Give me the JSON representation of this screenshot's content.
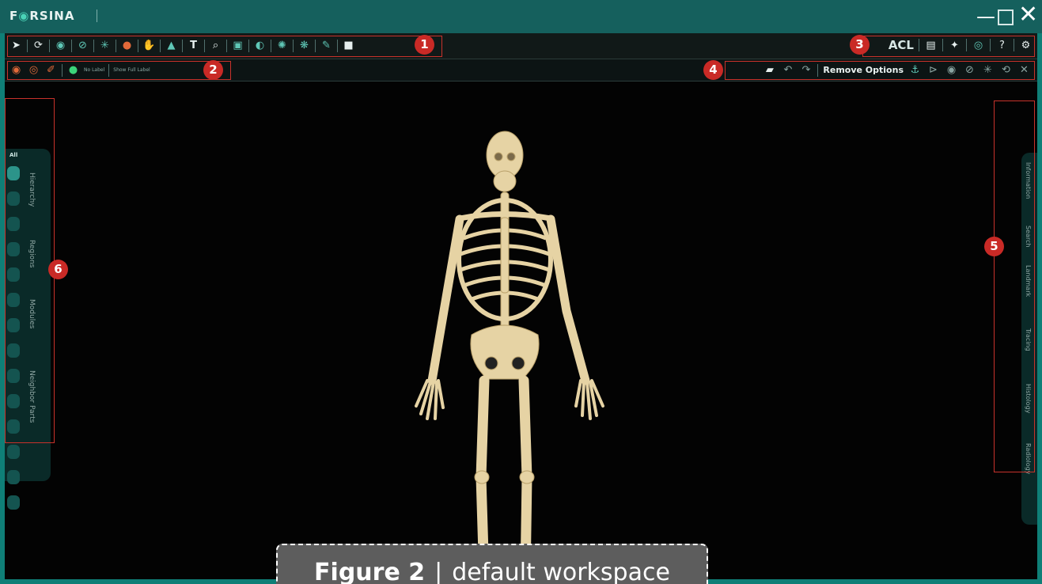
{
  "window": {
    "app_name_pre": "F",
    "app_name_o": "◉",
    "app_name_post": "RSINA",
    "minimize": "—",
    "close": "✕"
  },
  "toolbar_main": {
    "icons": [
      "pointer-icon",
      "rotate-icon",
      "eye-icon",
      "hide-icon",
      "explode-icon",
      "dot-icon",
      "hand-icon",
      "layer-icon",
      "text-icon",
      "zoom-icon",
      "image-icon",
      "mirror-icon",
      "atom-icon",
      "molecule-icon",
      "draw-icon",
      "video-icon"
    ],
    "acl_label": "ACL",
    "right_icons": [
      "document-icon",
      "puzzle-icon",
      "settings-circle-icon",
      "help-icon",
      "gear-icon"
    ]
  },
  "toolbar_secondary": {
    "no_label": "No Label",
    "show_full_label": "Show Full Label",
    "remove_options_label": "Remove Options"
  },
  "callouts": {
    "m1": "1",
    "m2": "2",
    "m3": "3",
    "m4": "4",
    "m5": "5",
    "m6": "6"
  },
  "left_panel": {
    "all_label": "All",
    "tabs": [
      "Hierarchy",
      "Regions",
      "Modules",
      "Neighbor Parts"
    ]
  },
  "right_panel": {
    "tabs": [
      "Information",
      "Search",
      "Landmark",
      "Tracing",
      "Histology",
      "Radiology"
    ]
  },
  "caption": {
    "figure_label": "Figure 2",
    "separator": "|",
    "description": "default workspace"
  },
  "colors": {
    "frame": "#0f7f77",
    "titlebar": "#15605d",
    "callout_red": "#c92a26",
    "bone": "#e6d3a4",
    "accent_teal": "#5fc7b6"
  }
}
